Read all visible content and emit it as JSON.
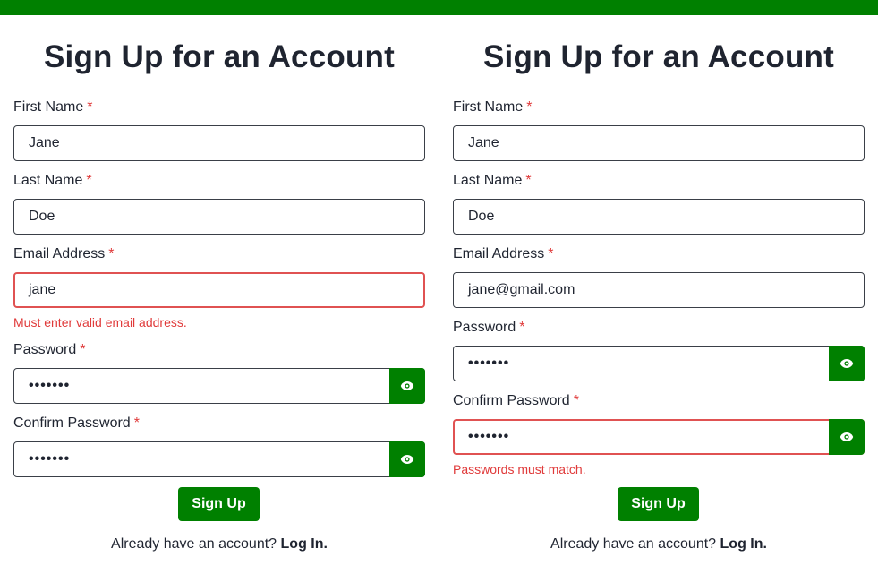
{
  "colors": {
    "accent": "#008000",
    "error": "#e03a3a",
    "text": "#1f2430"
  },
  "left": {
    "title": "Sign Up for an Account",
    "first_name_label": "First Name",
    "first_name_value": "Jane",
    "last_name_label": "Last Name",
    "last_name_value": "Doe",
    "email_label": "Email Address",
    "email_value": "jane",
    "email_error": "Must enter valid email address.",
    "password_label": "Password",
    "password_value": "•••••••",
    "confirm_label": "Confirm Password",
    "confirm_value": "•••••••",
    "required_mark": "*",
    "signup_label": "Sign Up",
    "login_prompt": "Already have an account?",
    "login_link": "Log In."
  },
  "right": {
    "title": "Sign Up for an Account",
    "first_name_label": "First Name",
    "first_name_value": "Jane",
    "last_name_label": "Last Name",
    "last_name_value": "Doe",
    "email_label": "Email Address",
    "email_value": "jane@gmail.com",
    "password_label": "Password",
    "password_value": "•••••••",
    "confirm_label": "Confirm Password",
    "confirm_value": "•••••••",
    "confirm_error": "Passwords must match.",
    "required_mark": "*",
    "signup_label": "Sign Up",
    "login_prompt": "Already have an account?",
    "login_link": "Log In."
  },
  "icons": {
    "password_toggle": "eye-icon"
  }
}
